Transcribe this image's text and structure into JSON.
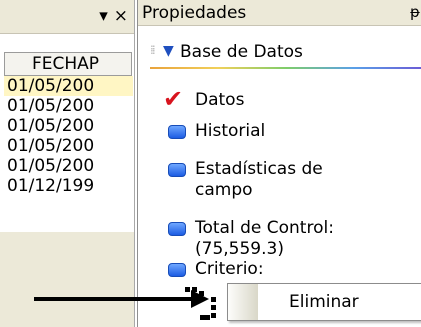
{
  "left_panel": {
    "dropdown_icon": "▾",
    "close_icon": "×",
    "column_header": "FECHAP",
    "rows": [
      "01/05/200",
      "01/05/200",
      "01/05/200",
      "01/05/200",
      "01/05/200",
      "01/12/199"
    ]
  },
  "properties_panel": {
    "title": "Propiedades",
    "pin_icon": "ᵽ",
    "group_title": "Base de Datos",
    "items": [
      {
        "label": "Datos",
        "icon": "checkmark-icon"
      },
      {
        "label": "Historial",
        "icon": "blue-bullet-icon"
      },
      {
        "label_line1": "Estadísticas de",
        "label_line2": "campo",
        "icon": "blue-bullet-icon"
      },
      {
        "label_line1": "Total de Control:",
        "label_line2": "(75,559.3)",
        "icon": "blue-bullet-icon"
      },
      {
        "label": "Criterio:",
        "icon": "blue-bullet-icon"
      }
    ]
  },
  "context_menu": {
    "items": [
      {
        "label": "Eliminar"
      }
    ]
  },
  "colors": {
    "check": "#d8141e",
    "bullet": "#1c5ce3",
    "group_triangle": "#1f4fbf",
    "selected_row": "#fff6c4"
  }
}
